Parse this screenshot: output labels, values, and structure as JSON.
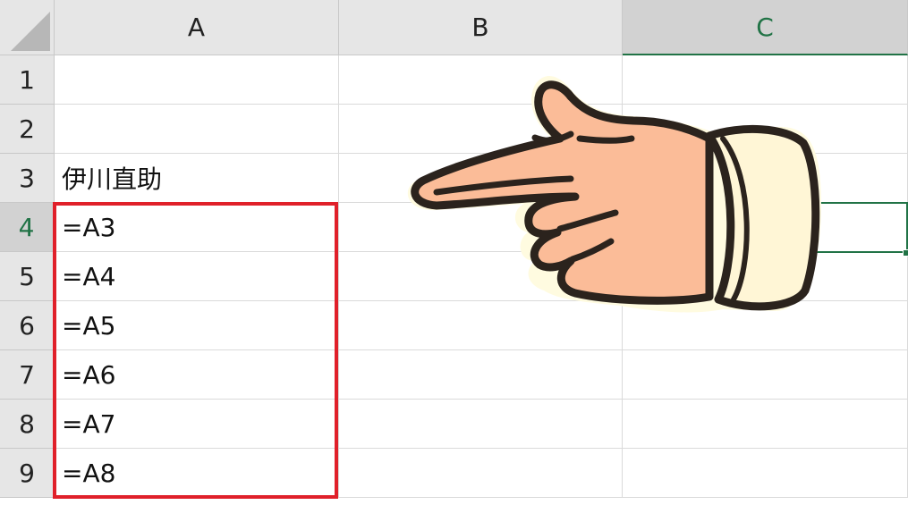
{
  "columns": [
    {
      "label": "A"
    },
    {
      "label": "B"
    },
    {
      "label": "C"
    }
  ],
  "rows": [
    "1",
    "2",
    "3",
    "4",
    "5",
    "6",
    "7",
    "8",
    "9"
  ],
  "cells": {
    "A3": "伊川直助",
    "A4": "=A3",
    "A5": "=A4",
    "A6": "=A5",
    "A7": "=A6",
    "A8": "=A7",
    "A9": "=A8"
  },
  "selection": {
    "active_cell": "C4",
    "active_column": "C",
    "active_row": "4"
  },
  "highlight": {
    "range": "A4:A9",
    "color": "#e0202a"
  },
  "colors": {
    "header_bg": "#e6e6e6",
    "selected_header_bg": "#d2d2d2",
    "excel_green": "#217346",
    "hand_skin": "#fbbc98",
    "hand_cuff": "#fff6d6",
    "outline": "#2b231d"
  },
  "icons": {
    "pointer": "pointing-hand-icon"
  }
}
